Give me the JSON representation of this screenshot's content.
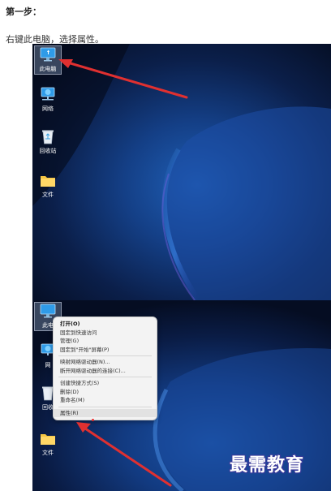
{
  "step": {
    "title": "第一步：",
    "description": "右键此电脑，选择属性。"
  },
  "screenshot1": {
    "icons": [
      {
        "name": "this-pc",
        "label": "此电脑",
        "icon": "computer-icon"
      },
      {
        "name": "network",
        "label": "网络",
        "icon": "network-icon"
      },
      {
        "name": "recycle-bin",
        "label": "回收站",
        "icon": "recycle-bin-icon"
      },
      {
        "name": "folder",
        "label": "文件",
        "icon": "folder-icon"
      }
    ]
  },
  "screenshot2": {
    "icons": [
      {
        "name": "this-pc",
        "label": "此电",
        "icon": "computer-icon"
      },
      {
        "name": "network",
        "label": "网",
        "icon": "network-icon"
      },
      {
        "name": "recycle-bin",
        "label": "回收",
        "icon": "recycle-bin-icon"
      },
      {
        "name": "folder",
        "label": "文件",
        "icon": "folder-icon"
      }
    ],
    "context_menu": {
      "groups": [
        [
          "打开(O)",
          "固定到快速访问",
          "管理(G)",
          "固定到\"开始\"屏幕(P)"
        ],
        [
          "映射网络驱动器(N)...",
          "断开网络驱动器的连接(C)..."
        ],
        [
          "创建快捷方式(S)",
          "删除(D)",
          "重命名(M)"
        ],
        [
          "属性(R)"
        ]
      ]
    },
    "watermark": "最需教育"
  },
  "colors": {
    "desktop_dark": "#0a1430",
    "desktop_blue": "#1b4fa0",
    "arrow_red": "#e03030",
    "menu_bg": "#f3f3f3"
  }
}
